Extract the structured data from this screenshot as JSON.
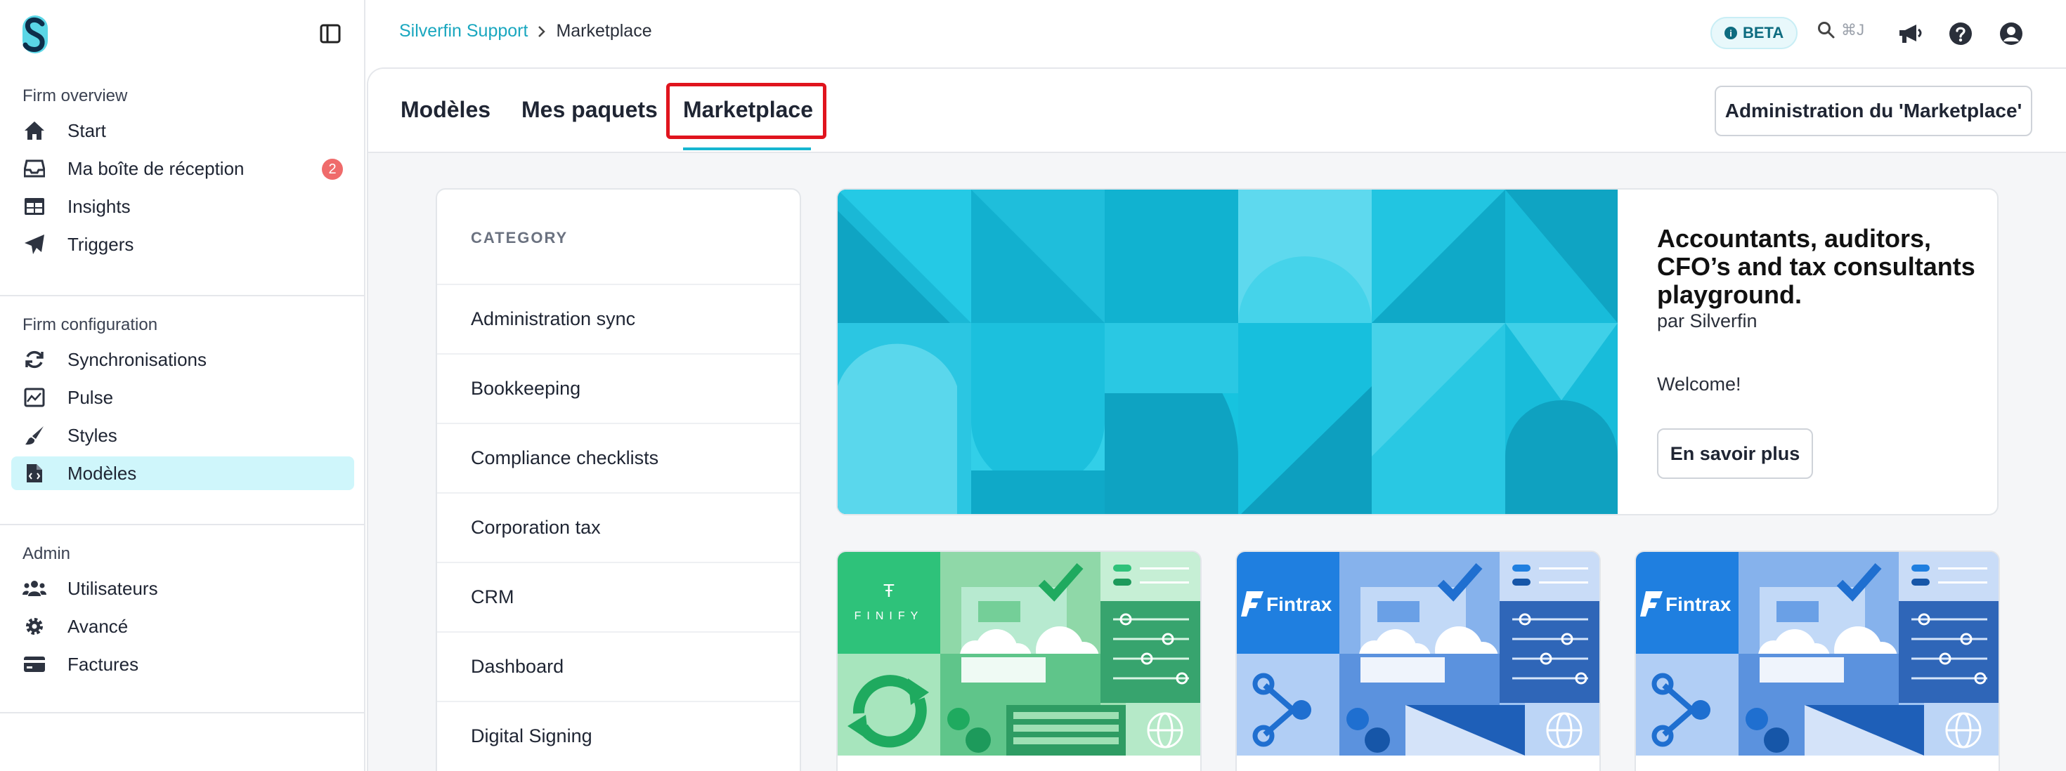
{
  "colors": {
    "accent": "#17b6d0",
    "link": "#1aa7bf",
    "active_bg": "#cff6fb",
    "badge": "#ef6b6b",
    "highlight": "#e0141e"
  },
  "sidebar": {
    "sections": [
      {
        "heading": "Firm overview",
        "items": [
          {
            "label": "Start",
            "icon": "home-icon"
          },
          {
            "label": "Ma boîte de réception",
            "icon": "inbox-icon",
            "badge": "2"
          },
          {
            "label": "Insights",
            "icon": "table-icon"
          },
          {
            "label": "Triggers",
            "icon": "paper-plane-icon"
          }
        ]
      },
      {
        "heading": "Firm configuration",
        "items": [
          {
            "label": "Synchronisations",
            "icon": "sync-icon"
          },
          {
            "label": "Pulse",
            "icon": "chart-icon"
          },
          {
            "label": "Styles",
            "icon": "brush-icon"
          },
          {
            "label": "Modèles",
            "icon": "file-code-icon",
            "active": true
          }
        ]
      },
      {
        "heading": "Admin",
        "items": [
          {
            "label": "Utilisateurs",
            "icon": "users-icon"
          },
          {
            "label": "Avancé",
            "icon": "gear-icon"
          },
          {
            "label": "Factures",
            "icon": "credit-card-icon"
          }
        ]
      }
    ]
  },
  "breadcrumb": {
    "parent": "Silverfin Support",
    "current": "Marketplace"
  },
  "topbar": {
    "beta_label": "BETA",
    "search_shortcut": "⌘J"
  },
  "tabs": [
    {
      "label": "Modèles"
    },
    {
      "label": "Mes paquets"
    },
    {
      "label": "Marketplace",
      "active": true
    }
  ],
  "admin_button": "Administration du 'Marketplace'",
  "category": {
    "heading": "CATEGORY",
    "items": [
      "Administration sync",
      "Bookkeeping",
      "Compliance checklists",
      "Corporation tax",
      "CRM",
      "Dashboard",
      "Digital Signing"
    ]
  },
  "hero": {
    "title": "Accountants, auditors, CFO’s and tax consultants playground.",
    "author": "par Silverfin",
    "welcome": "Welcome!",
    "button": "En savoir plus"
  },
  "cards": [
    {
      "brand": "FINIFY",
      "theme": "green"
    },
    {
      "brand": "Fintrax",
      "theme": "blue"
    },
    {
      "brand": "Fintrax",
      "theme": "blue"
    }
  ]
}
